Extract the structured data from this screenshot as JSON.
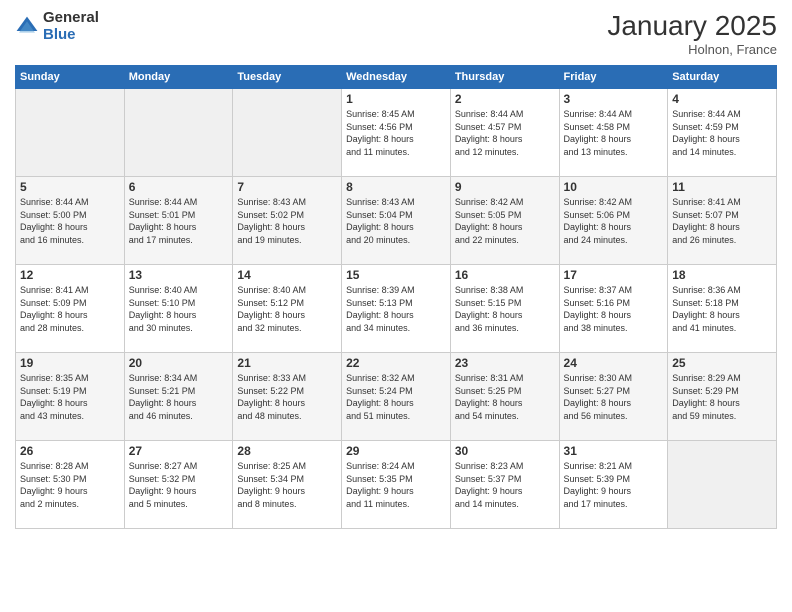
{
  "logo": {
    "general": "General",
    "blue": "Blue"
  },
  "title": "January 2025",
  "location": "Holnon, France",
  "days_of_week": [
    "Sunday",
    "Monday",
    "Tuesday",
    "Wednesday",
    "Thursday",
    "Friday",
    "Saturday"
  ],
  "weeks": [
    [
      {
        "day": "",
        "info": ""
      },
      {
        "day": "",
        "info": ""
      },
      {
        "day": "",
        "info": ""
      },
      {
        "day": "1",
        "info": "Sunrise: 8:45 AM\nSunset: 4:56 PM\nDaylight: 8 hours\nand 11 minutes."
      },
      {
        "day": "2",
        "info": "Sunrise: 8:44 AM\nSunset: 4:57 PM\nDaylight: 8 hours\nand 12 minutes."
      },
      {
        "day": "3",
        "info": "Sunrise: 8:44 AM\nSunset: 4:58 PM\nDaylight: 8 hours\nand 13 minutes."
      },
      {
        "day": "4",
        "info": "Sunrise: 8:44 AM\nSunset: 4:59 PM\nDaylight: 8 hours\nand 14 minutes."
      }
    ],
    [
      {
        "day": "5",
        "info": "Sunrise: 8:44 AM\nSunset: 5:00 PM\nDaylight: 8 hours\nand 16 minutes."
      },
      {
        "day": "6",
        "info": "Sunrise: 8:44 AM\nSunset: 5:01 PM\nDaylight: 8 hours\nand 17 minutes."
      },
      {
        "day": "7",
        "info": "Sunrise: 8:43 AM\nSunset: 5:02 PM\nDaylight: 8 hours\nand 19 minutes."
      },
      {
        "day": "8",
        "info": "Sunrise: 8:43 AM\nSunset: 5:04 PM\nDaylight: 8 hours\nand 20 minutes."
      },
      {
        "day": "9",
        "info": "Sunrise: 8:42 AM\nSunset: 5:05 PM\nDaylight: 8 hours\nand 22 minutes."
      },
      {
        "day": "10",
        "info": "Sunrise: 8:42 AM\nSunset: 5:06 PM\nDaylight: 8 hours\nand 24 minutes."
      },
      {
        "day": "11",
        "info": "Sunrise: 8:41 AM\nSunset: 5:07 PM\nDaylight: 8 hours\nand 26 minutes."
      }
    ],
    [
      {
        "day": "12",
        "info": "Sunrise: 8:41 AM\nSunset: 5:09 PM\nDaylight: 8 hours\nand 28 minutes."
      },
      {
        "day": "13",
        "info": "Sunrise: 8:40 AM\nSunset: 5:10 PM\nDaylight: 8 hours\nand 30 minutes."
      },
      {
        "day": "14",
        "info": "Sunrise: 8:40 AM\nSunset: 5:12 PM\nDaylight: 8 hours\nand 32 minutes."
      },
      {
        "day": "15",
        "info": "Sunrise: 8:39 AM\nSunset: 5:13 PM\nDaylight: 8 hours\nand 34 minutes."
      },
      {
        "day": "16",
        "info": "Sunrise: 8:38 AM\nSunset: 5:15 PM\nDaylight: 8 hours\nand 36 minutes."
      },
      {
        "day": "17",
        "info": "Sunrise: 8:37 AM\nSunset: 5:16 PM\nDaylight: 8 hours\nand 38 minutes."
      },
      {
        "day": "18",
        "info": "Sunrise: 8:36 AM\nSunset: 5:18 PM\nDaylight: 8 hours\nand 41 minutes."
      }
    ],
    [
      {
        "day": "19",
        "info": "Sunrise: 8:35 AM\nSunset: 5:19 PM\nDaylight: 8 hours\nand 43 minutes."
      },
      {
        "day": "20",
        "info": "Sunrise: 8:34 AM\nSunset: 5:21 PM\nDaylight: 8 hours\nand 46 minutes."
      },
      {
        "day": "21",
        "info": "Sunrise: 8:33 AM\nSunset: 5:22 PM\nDaylight: 8 hours\nand 48 minutes."
      },
      {
        "day": "22",
        "info": "Sunrise: 8:32 AM\nSunset: 5:24 PM\nDaylight: 8 hours\nand 51 minutes."
      },
      {
        "day": "23",
        "info": "Sunrise: 8:31 AM\nSunset: 5:25 PM\nDaylight: 8 hours\nand 54 minutes."
      },
      {
        "day": "24",
        "info": "Sunrise: 8:30 AM\nSunset: 5:27 PM\nDaylight: 8 hours\nand 56 minutes."
      },
      {
        "day": "25",
        "info": "Sunrise: 8:29 AM\nSunset: 5:29 PM\nDaylight: 8 hours\nand 59 minutes."
      }
    ],
    [
      {
        "day": "26",
        "info": "Sunrise: 8:28 AM\nSunset: 5:30 PM\nDaylight: 9 hours\nand 2 minutes."
      },
      {
        "day": "27",
        "info": "Sunrise: 8:27 AM\nSunset: 5:32 PM\nDaylight: 9 hours\nand 5 minutes."
      },
      {
        "day": "28",
        "info": "Sunrise: 8:25 AM\nSunset: 5:34 PM\nDaylight: 9 hours\nand 8 minutes."
      },
      {
        "day": "29",
        "info": "Sunrise: 8:24 AM\nSunset: 5:35 PM\nDaylight: 9 hours\nand 11 minutes."
      },
      {
        "day": "30",
        "info": "Sunrise: 8:23 AM\nSunset: 5:37 PM\nDaylight: 9 hours\nand 14 minutes."
      },
      {
        "day": "31",
        "info": "Sunrise: 8:21 AM\nSunset: 5:39 PM\nDaylight: 9 hours\nand 17 minutes."
      },
      {
        "day": "",
        "info": ""
      }
    ]
  ]
}
